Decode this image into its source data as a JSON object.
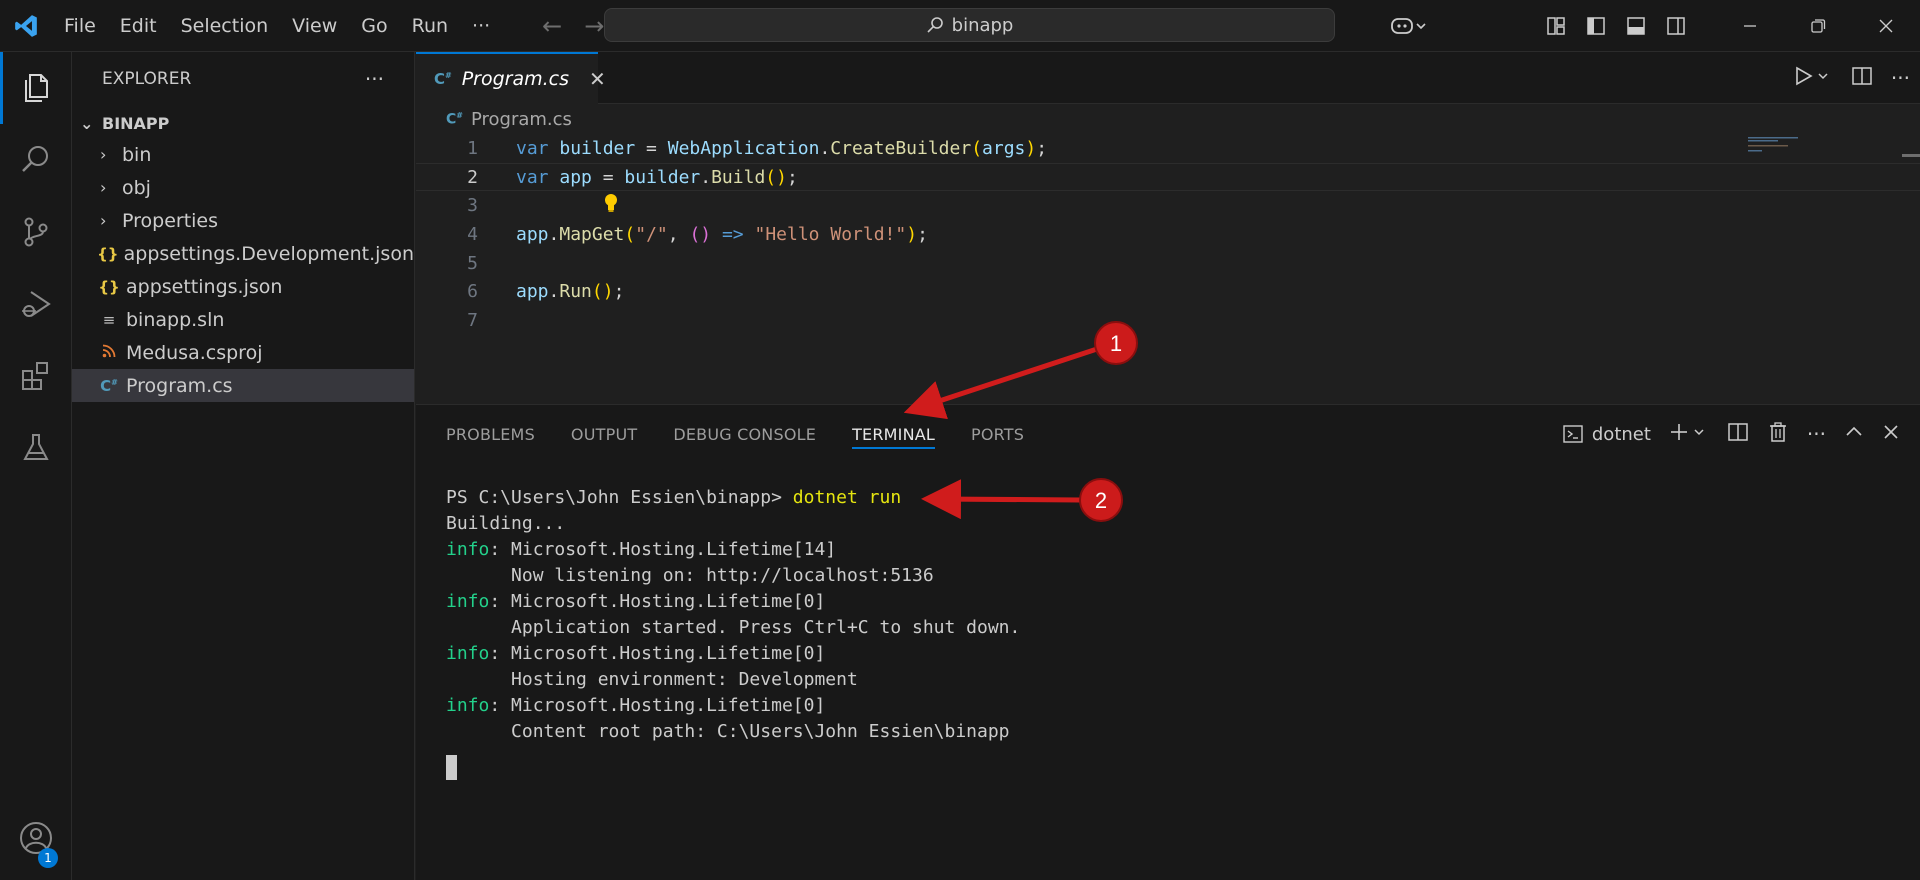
{
  "titlebar": {
    "menu": [
      "File",
      "Edit",
      "Selection",
      "View",
      "Go",
      "Run"
    ],
    "more": "···",
    "search_text": "binapp"
  },
  "activitybar": {
    "icons": [
      "files-icon",
      "search-icon",
      "source-control-icon",
      "run-debug-icon",
      "extensions-icon",
      "testing-icon"
    ],
    "account_badge": "1"
  },
  "sidebar": {
    "title": "EXPLORER",
    "more": "···",
    "root": "BINAPP",
    "items": [
      {
        "label": "bin",
        "kind": "folder"
      },
      {
        "label": "obj",
        "kind": "folder"
      },
      {
        "label": "Properties",
        "kind": "folder"
      },
      {
        "label": "appsettings.Development.json",
        "kind": "json"
      },
      {
        "label": "appsettings.json",
        "kind": "json"
      },
      {
        "label": "binapp.sln",
        "kind": "sln"
      },
      {
        "label": "Medusa.csproj",
        "kind": "rss"
      },
      {
        "label": "Program.cs",
        "kind": "cs",
        "selected": true
      }
    ]
  },
  "editor": {
    "tab_label": "Program.cs",
    "breadcrumb": "Program.cs",
    "line_numbers": [
      "1",
      "2",
      "3",
      "4",
      "5",
      "6",
      "7"
    ],
    "current_line": "2"
  },
  "panel": {
    "tabs": [
      "PROBLEMS",
      "OUTPUT",
      "DEBUG CONSOLE",
      "TERMINAL",
      "PORTS"
    ],
    "active_tab": "TERMINAL",
    "terminal_name": "dotnet",
    "lines": {
      "prompt": "PS C:\\Users\\John Essien\\binapp> ",
      "command": "dotnet run",
      "building": "Building...",
      "info": "info",
      "l1": ": Microsoft.Hosting.Lifetime[14]",
      "l2": "      Now listening on: http://localhost:5136",
      "l3": ": Microsoft.Hosting.Lifetime[0]",
      "l4": "      Application started. Press Ctrl+C to shut down.",
      "l5": ": Microsoft.Hosting.Lifetime[0]",
      "l6": "      Hosting environment: Development",
      "l7": ": Microsoft.Hosting.Lifetime[0]",
      "l8": "      Content root path: C:\\Users\\John Essien\\binapp"
    }
  },
  "annotations": [
    {
      "number": "1",
      "points_to": "TERMINAL tab"
    },
    {
      "number": "2",
      "points_to": "dotnet run command"
    }
  ],
  "colors": {
    "accent": "#0078d4",
    "annotation": "#d01c1c",
    "info": "#23d18b",
    "command": "#e5e510"
  }
}
